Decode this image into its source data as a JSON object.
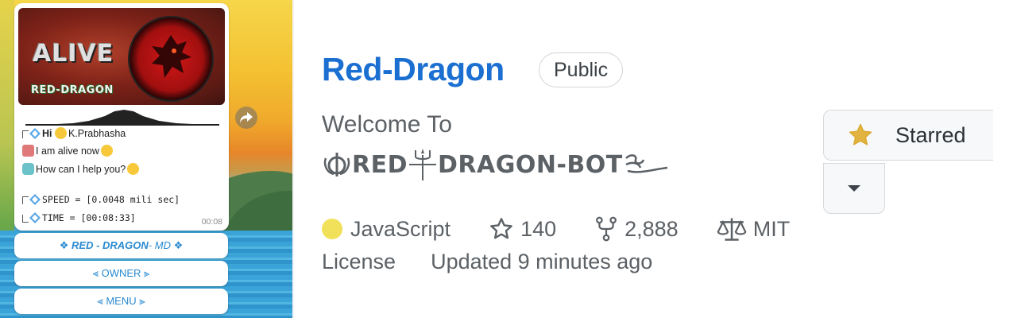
{
  "chat": {
    "banner_title": "ALIVE",
    "banner_subtitle": "RED-DRAGON",
    "messages": {
      "greeting_hi": "Hi",
      "greeting_name": "K.Prabhasha",
      "alive": "I am alive now",
      "help": "How can I help you?",
      "speed_label": "SPEED",
      "speed_value": " = [0.0048 mili sec]",
      "time_label": "TIME",
      "time_value": "  = [00:08:33]"
    },
    "timestamp": "00:08",
    "buttons": {
      "bot_name_main": "❖ RED - DRAGON",
      "bot_name_suffix": " - MD ❖",
      "owner": "⫷ OWNER ⫸",
      "menu": "⫷ MENU ⫸"
    }
  },
  "repo": {
    "name": "Red-Dragon",
    "visibility": "Public",
    "description_line1": "Welcome To",
    "description_part_a": "RED",
    "description_part_b": "DRAGON-BOT",
    "language": "JavaScript",
    "language_color": "#f1e05a",
    "stars": "140",
    "forks": "2,888",
    "license_name": "MIT",
    "license_word": "License",
    "updated": "Updated 9 minutes ago",
    "star_button_label": "Starred",
    "accent_color": "#1b6fd1"
  }
}
